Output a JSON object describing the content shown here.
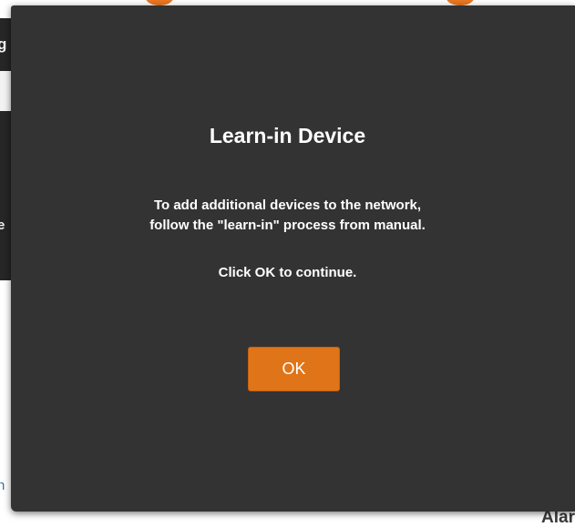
{
  "background": {
    "left_edge_letters": [
      "g",
      "e",
      "n"
    ],
    "bottom_right_text": "Alar"
  },
  "dialog": {
    "title": "Learn-in Device",
    "message_line_1": "To add additional devices to the network,",
    "message_line_2": "follow the \"learn-in\" process from manual.",
    "message_line_3": "Click OK to continue.",
    "ok_label": "OK"
  },
  "colors": {
    "dialog_background": "#333333",
    "accent_button": "#e07418",
    "text": "#ffffff"
  }
}
